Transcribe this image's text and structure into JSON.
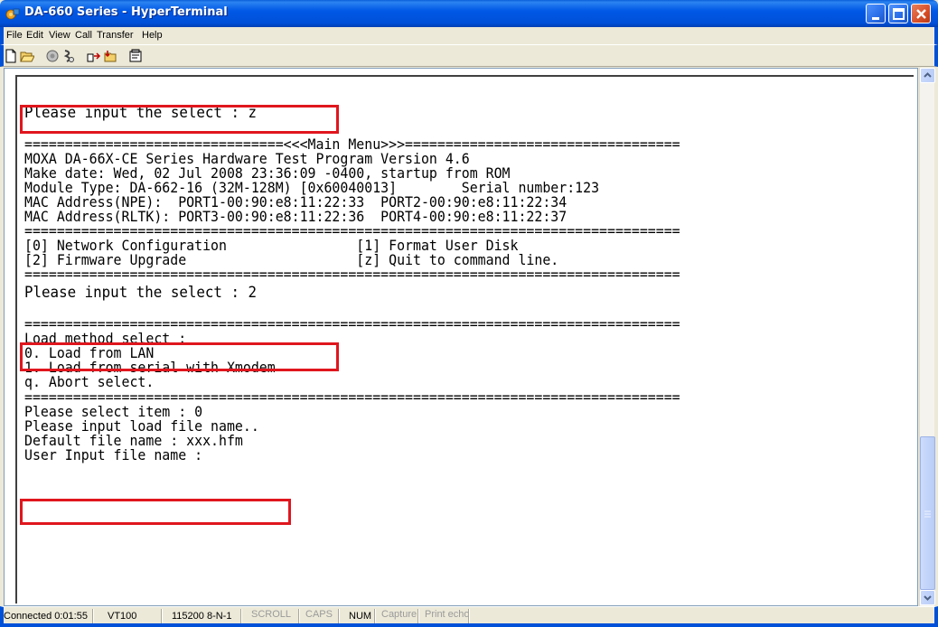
{
  "window": {
    "title": "DA-660 Series - HyperTerminal"
  },
  "menu": [
    "File",
    "Edit",
    "View",
    "Call",
    "Transfer",
    "Help"
  ],
  "toolbar": [
    "new-icon",
    "open-icon",
    "connect-icon",
    "disconnect-icon",
    "send-icon",
    "receive-icon",
    "properties-icon"
  ],
  "terminal": {
    "lines": [
      "Please input the select : z",
      "",
      "================================<<<Main Menu>>>==================================",
      "MOXA DA-66X-CE Series Hardware Test Program Version 4.6",
      "Make date: Wed, 02 Jul 2008 23:36:09 -0400, startup from ROM",
      "Module Type: DA-662-16 (32M-128M) [0x60040013]        Serial number:123",
      "MAC Address(NPE):  PORT1-00:90:e8:11:22:33  PORT2-00:90:e8:11:22:34",
      "MAC Address(RLTK): PORT3-00:90:e8:11:22:36  PORT4-00:90:e8:11:22:37",
      "=================================================================================",
      "[0] Network Configuration                [1] Format User Disk",
      "[2] Firmware Upgrade                     [z] Quit to command line.",
      "=================================================================================",
      "Please input the select : 2",
      "",
      "",
      "=================================================================================",
      "Load method select :",
      "0. Load from LAN",
      "1. Load from serial with Xmodem",
      "q. Abort select.",
      "",
      "=================================================================================",
      "Please select item : 0",
      "Please input load file name..",
      "Default file name : xxx.hfm",
      "User Input file name :"
    ]
  },
  "statusbar": {
    "connected": "Connected 0:01:55",
    "emulation": "VT100",
    "settings": "115200 8-N-1",
    "scroll": "SCROLL",
    "caps": "CAPS",
    "num": "NUM",
    "capture": "Capture",
    "print_echo": "Print echo"
  },
  "colors": {
    "titlebar": "#0058e6",
    "highlight": "#e0161e",
    "terminal_bg": "#ffffff"
  }
}
